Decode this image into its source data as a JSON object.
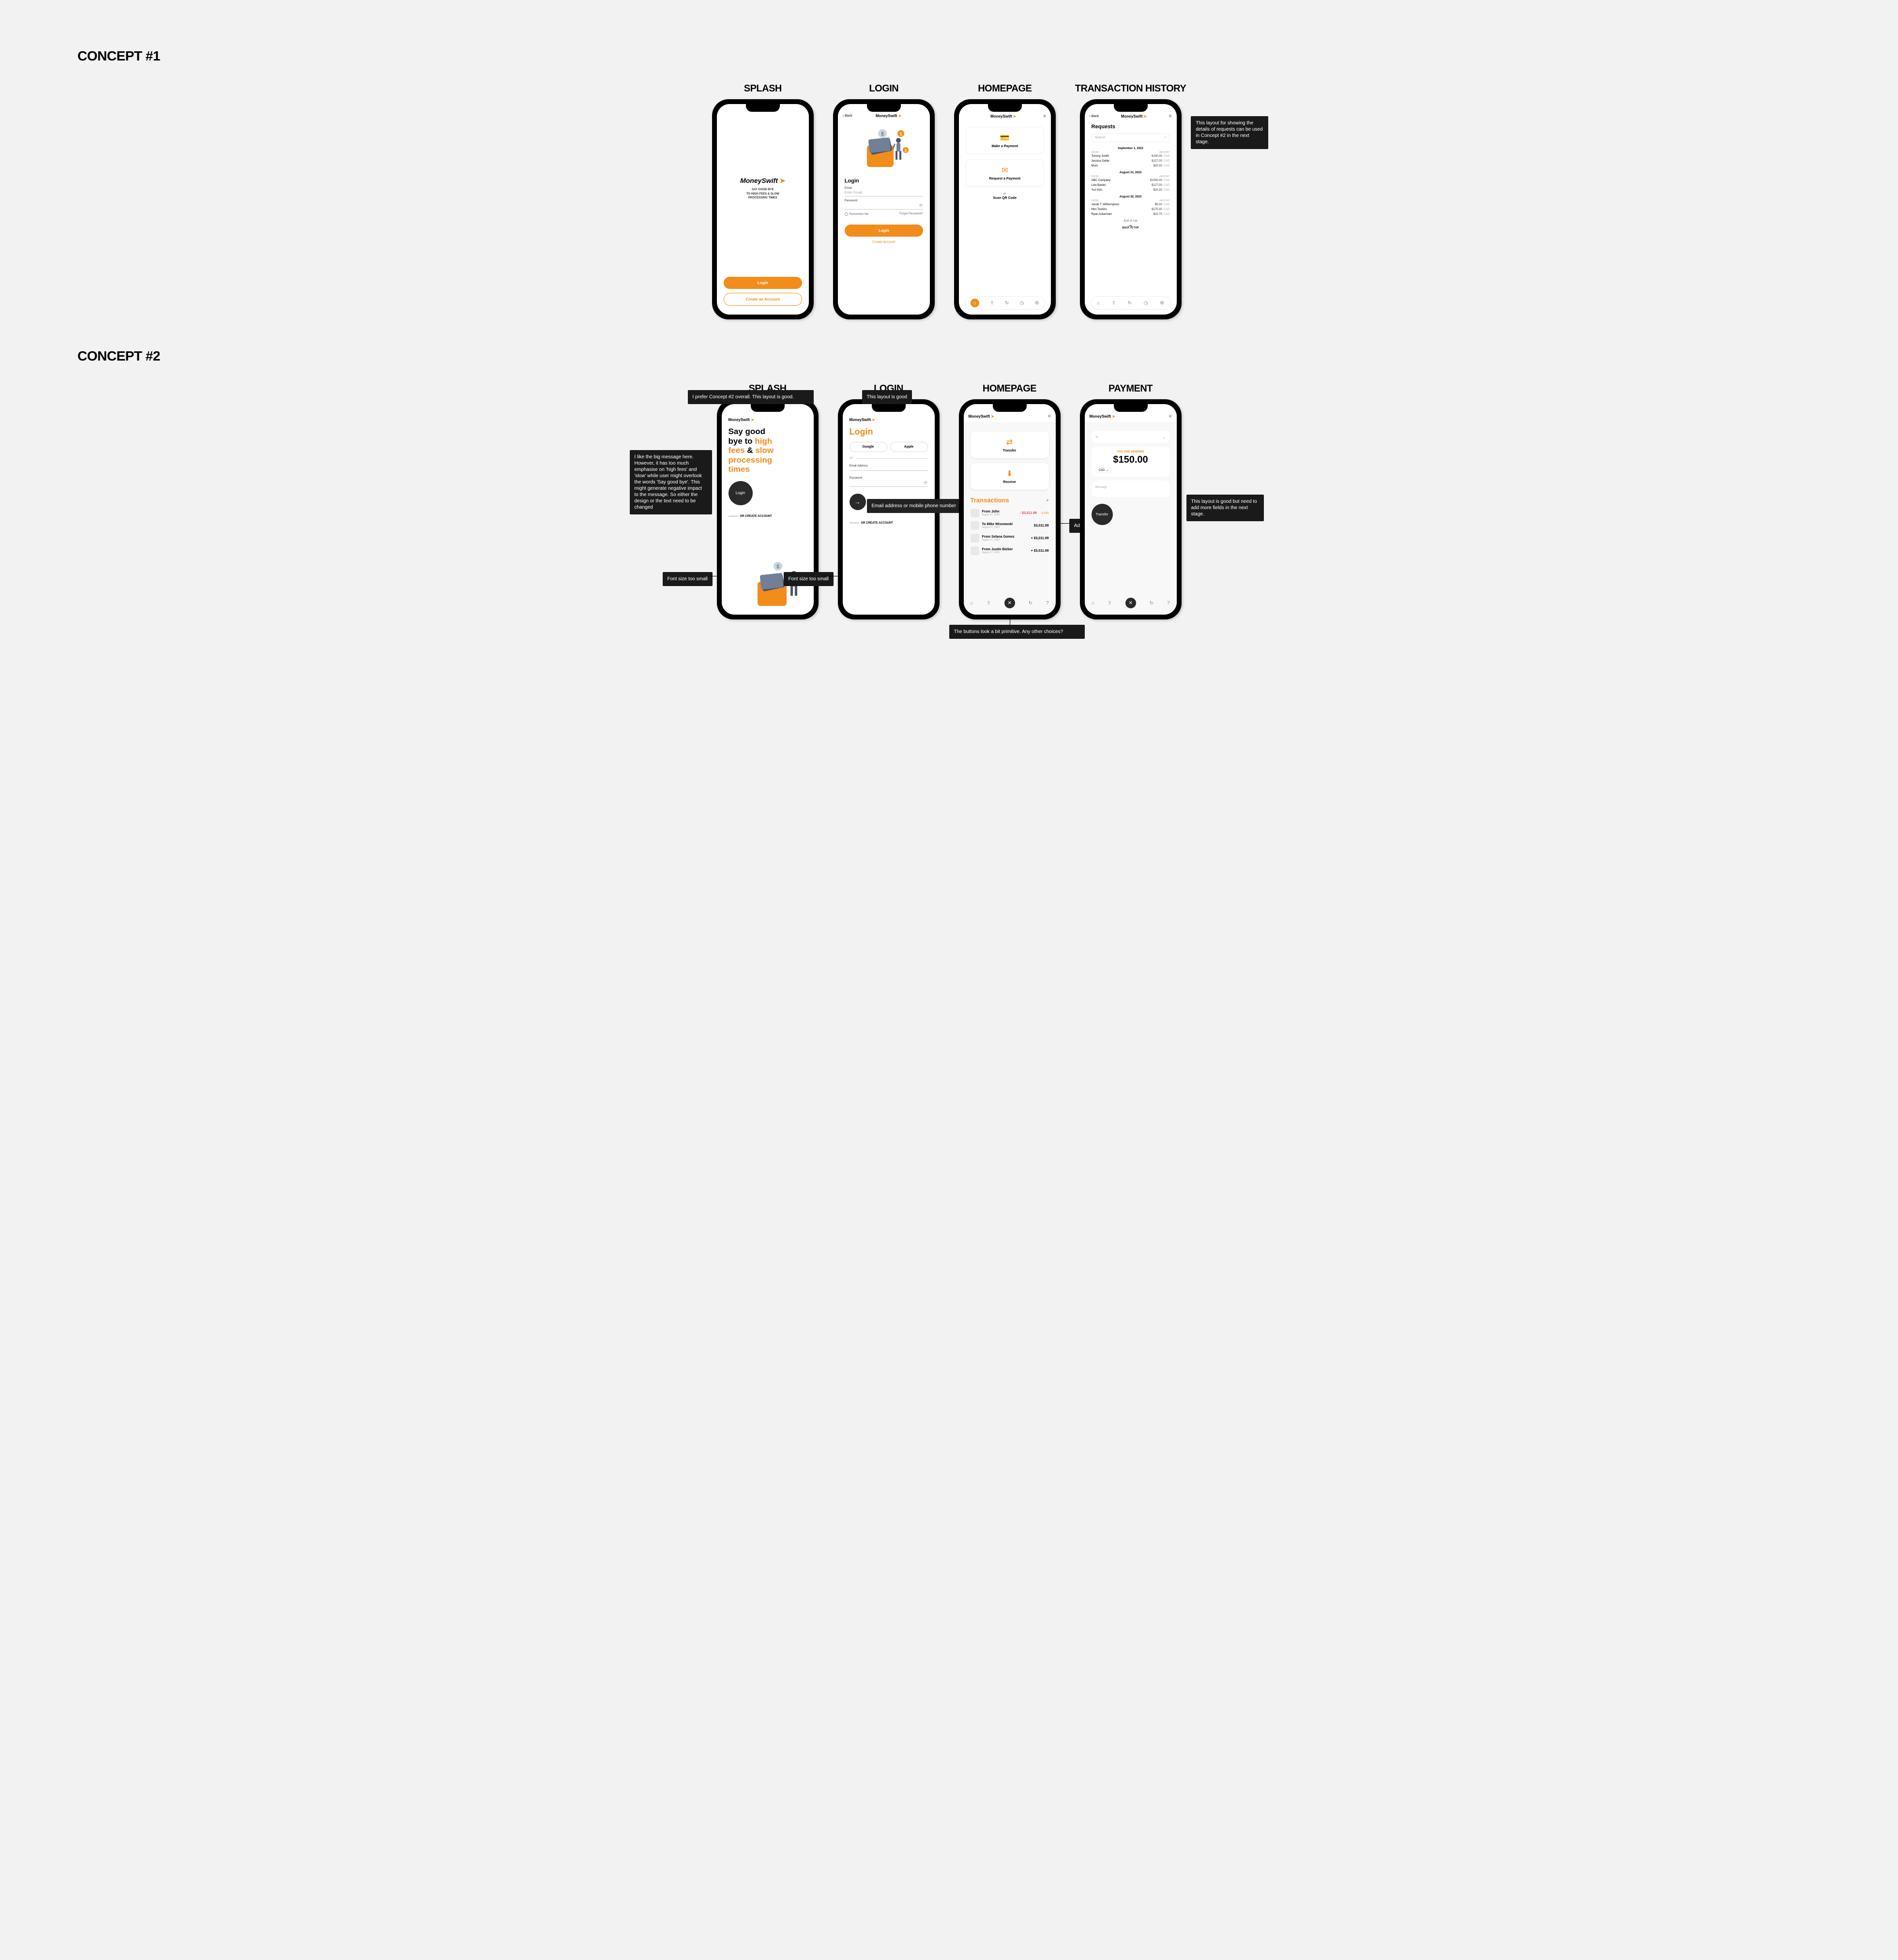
{
  "concepts": {
    "c1": "CONCEPT #1",
    "c2": "CONCEPT #2"
  },
  "labels": {
    "splash": "SPLASH",
    "login": "LOGIN",
    "homepage": "HOMEPAGE",
    "history": "TRANSACTION HISTORY",
    "payment": "PAYMENT"
  },
  "brand": {
    "name": "MoneySwift",
    "glyph": "➤"
  },
  "back": "‹ Back",
  "c1": {
    "splash": {
      "tag1": "SAY GOOD BYE",
      "tag2": "TO HIGH FEES & SLOW",
      "tag3": "PROCESSING TIMES",
      "login": "Login",
      "create": "Create an Account"
    },
    "login": {
      "title": "Login",
      "email_lbl": "Email",
      "email_ph": "Enter Email",
      "pass_lbl": "Password",
      "remember": "Remember Me",
      "forgot": "Forgot Password?",
      "login_btn": "Login",
      "create": "Create Account"
    },
    "home": {
      "make": "Make a Payment",
      "request": "Request a Payment",
      "or": "or",
      "scan": "Scan QR Code"
    },
    "history": {
      "title": "Requests",
      "search": "Search",
      "col_from": "FROM",
      "col_amount": "AMOUNT",
      "sections": [
        {
          "date": "September 1, 2023",
          "rows": [
            {
              "from": "Tommy Smith",
              "amount": "$100.00",
              "cur": "CAD"
            },
            {
              "from": "Jessica Geller",
              "amount": "$127.00",
              "cur": "CAD"
            },
            {
              "from": "Mom",
              "amount": "$20.00",
              "cur": "CAD"
            }
          ]
        },
        {
          "date": "August 31, 2023",
          "rows": [
            {
              "from": "ABC Company",
              "amount": "$1000.00",
              "cur": "CAD"
            },
            {
              "from": "Levi Baxter",
              "amount": "$127.00",
              "cur": "CAD"
            },
            {
              "from": "Yuri Kim",
              "amount": "$20.00",
              "cur": "CAD"
            }
          ]
        },
        {
          "date": "August 30, 2023",
          "rows": [
            {
              "from": "Jacob T. Witherspoon",
              "amount": "$5.00",
              "cur": "CAD"
            },
            {
              "from": "Hiro Toshiro",
              "amount": "$175.00",
              "cur": "CAD"
            },
            {
              "from": "Ryan Ackerman",
              "amount": "$20.75",
              "cur": "CAD"
            }
          ]
        }
      ],
      "eol": "End of List",
      "back_top": "BACK TO TOP"
    }
  },
  "c2": {
    "splash": {
      "line1": "Say good",
      "line2": "bye to ",
      "hl1": "high",
      "line3": "fees",
      "amp": " & ",
      "hl2": "slow",
      "line4": "processing",
      "line5": "times",
      "login": "Login",
      "orcreate": "OR CREATE ACCOUNT"
    },
    "login": {
      "title": "Login",
      "google": "Google",
      "apple": "Apple",
      "or": "OR",
      "email_lbl": "Email Address",
      "pass_lbl": "Password",
      "orcreate": "OR CREATE ACCOUNT"
    },
    "home": {
      "transfer": "Transfer",
      "receive": "Receive",
      "trans_hdr": "Transactions",
      "aug": "- 4,934",
      "rows": [
        {
          "name": "From John",
          "date": "August 27, 2023",
          "amt": "- $3,011.99",
          "neg": true
        },
        {
          "name": "To Mike Wisnowski",
          "date": "August 27, 2023",
          "amt": "$3,011.99",
          "neg": false
        },
        {
          "name": "From Selana Gomez",
          "date": "August 27, 2023",
          "amt": "+ $3,011.99",
          "neg": false
        },
        {
          "name": "From Justin Bieber",
          "date": "August 27, 2023",
          "amt": "+ $3,011.99",
          "neg": false
        }
      ]
    },
    "pay": {
      "to": "To",
      "sending": "YOU ARE SENDING",
      "amount": "$150.00",
      "currency": "CAD",
      "msg": "Message",
      "transfer": "Transfer"
    }
  },
  "annotations": {
    "a1": "This layout for showing the details of requests can be used in Concept #2 in the next stage.",
    "a2": "I prefer Concept #2 overall. This layout is good.",
    "a3": "I like the big message here. However, it has too much emphasise on 'high fees' and 'slow' while user might overlook the words 'Say good bye'. This might generate negative impact to the message. So either the design or the text need to be changed",
    "a4": "Font size too small",
    "a5": "This layout is good",
    "a6": "Email address or mobile phone number",
    "a7": "Font size too small",
    "a8": "Add currency here",
    "a9": "The buttons look a bit primitive. Any other choices?",
    "a10": "This layout is good but need to add more fields in the next stage."
  }
}
